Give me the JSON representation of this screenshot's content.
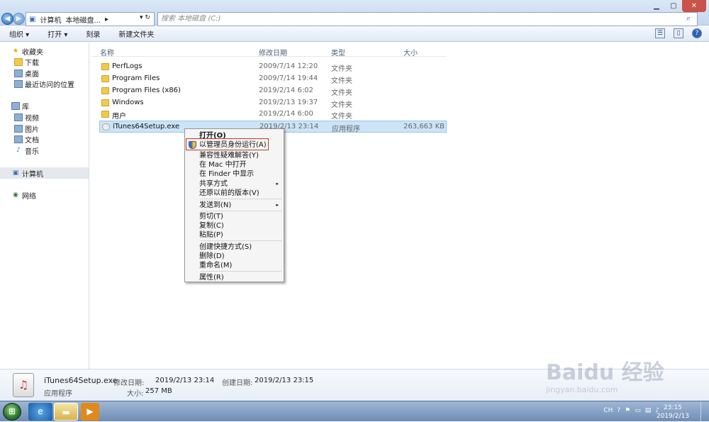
{
  "address": {
    "crumbs": [
      "计算机",
      "本地磁盘...",
      "▸"
    ],
    "search_placeholder": "搜索 本地磁盘 (C:)"
  },
  "toolbar": {
    "organize": "组织 ▾",
    "open": "打开 ▾",
    "burn": "刻录",
    "new_folder": "新建文件夹"
  },
  "nav": {
    "favorites": "收藏夹",
    "downloads": "下载",
    "desktop": "桌面",
    "recent": "最近访问的位置",
    "libraries": "库",
    "videos": "视频",
    "pictures": "图片",
    "documents": "文档",
    "music": "音乐",
    "computer": "计算机",
    "network": "网络"
  },
  "columns": {
    "name": "名称",
    "date": "修改日期",
    "type": "类型",
    "size": "大小"
  },
  "files": [
    {
      "name": "PerfLogs",
      "date": "2009/7/14 12:20",
      "type": "文件夹",
      "size": ""
    },
    {
      "name": "Program Files",
      "date": "2009/7/14 19:44",
      "type": "文件夹",
      "size": ""
    },
    {
      "name": "Program Files (x86)",
      "date": "2019/2/14 6:02",
      "type": "文件夹",
      "size": ""
    },
    {
      "name": "Windows",
      "date": "2019/2/13 19:37",
      "type": "文件夹",
      "size": ""
    },
    {
      "name": "用户",
      "date": "2019/2/14 6:00",
      "type": "文件夹",
      "size": ""
    },
    {
      "name": "iTunes64Setup.exe",
      "date": "2019/2/13 23:14",
      "type": "应用程序",
      "size": "263,663 KB"
    }
  ],
  "context_menu": {
    "open": "打开(O)",
    "run_as_admin": "以管理员身份运行(A)",
    "compat": "兼容性疑难解答(Y)",
    "open_mac": "在 Mac 中打开",
    "show_finder": "在 Finder 中显示",
    "share": "共享方式",
    "restore": "还原以前的版本(V)",
    "send_to": "发送到(N)",
    "cut": "剪切(T)",
    "copy": "复制(C)",
    "paste": "粘贴(P)",
    "shortcut": "创建快捷方式(S)",
    "delete": "删除(D)",
    "rename": "重命名(M)",
    "properties": "属性(R)"
  },
  "details": {
    "filename": "iTunes64Setup.exe",
    "filetype": "应用程序",
    "modified_label": "修改日期:",
    "modified": "2019/2/13 23:14",
    "created_label": "创建日期:",
    "created": "2019/2/13 23:15",
    "size_label": "大小:",
    "size": "257 MB"
  },
  "taskbar": {
    "lang": "CH",
    "time": "23:15",
    "date": "2019/2/13"
  },
  "watermark": {
    "brand": "Baidu 经验",
    "url": "jingyan.baidu.com"
  }
}
